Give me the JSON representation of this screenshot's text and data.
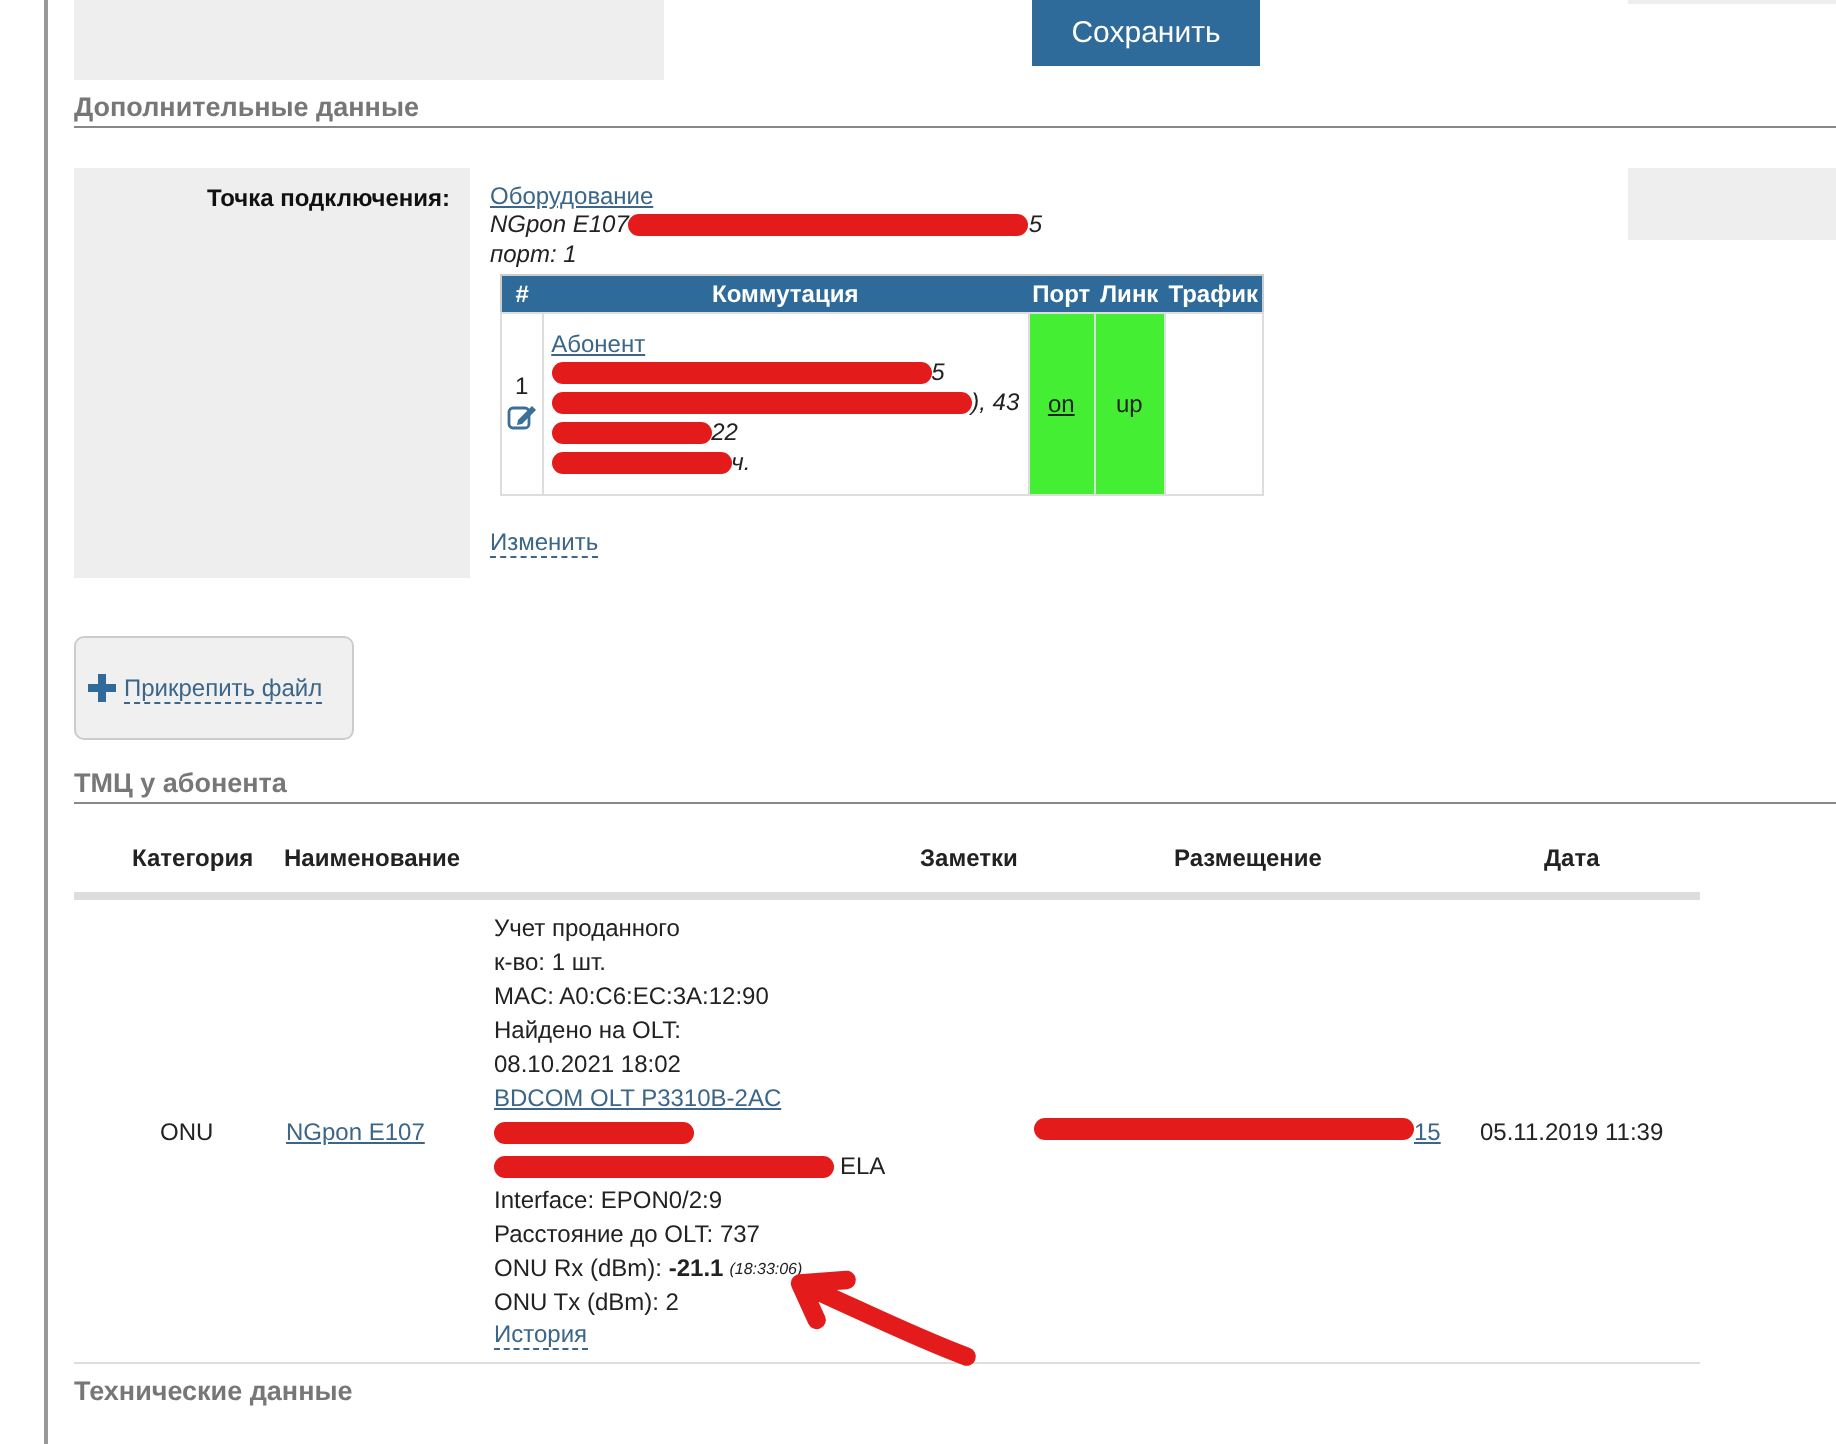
{
  "save_button": "Сохранить",
  "additional": {
    "heading": "Дополнительные данные",
    "label": "Точка подключения:",
    "equipment_link": "Оборудование",
    "device": "NGpon E107",
    "device_tail": "5",
    "port": "порт: 1",
    "switching_table": {
      "columns": [
        "#",
        "Коммутация",
        "Порт",
        "Линк",
        "Трафик"
      ],
      "rows": [
        {
          "number": "1",
          "subscriber_link": "Абонент",
          "line_tails": [
            "5",
            "), 43",
            "22",
            "ч."
          ],
          "port": "on",
          "link": "up",
          "port_up": true
        }
      ]
    },
    "change_link": "Изменить"
  },
  "attach_button": "Прикрепить файл",
  "inventory": {
    "heading": "ТМЦ у абонента",
    "columns": [
      "Категория",
      "Наименование",
      "Заметки",
      "Размещение",
      "Дата"
    ],
    "rows": [
      {
        "category": "ONU",
        "name": "NGpon E107",
        "notes_before": [
          "Учет проданного",
          "к-во: 1 шт.",
          "MAC: A0:C6:EC:3A:12:90",
          "Найдено на OLT:",
          "08.10.2021 18:02"
        ],
        "olt_link": "BDCOM OLT P3310B-2AC",
        "redacted_tail": "ELA",
        "notes_after": [
          "Interface: EPON0/2:9",
          "Расстояние до OLT: 737"
        ],
        "rx_label": "ONU Rx (dBm): ",
        "rx_value": "-21.1",
        "rx_time": "(18:33:06)",
        "tx": "ONU Tx (dBm): 2",
        "history_link": "История",
        "placement_tail": "15",
        "date": "05.11.2019 11:39"
      }
    ]
  },
  "technical_heading": "Технические данные"
}
